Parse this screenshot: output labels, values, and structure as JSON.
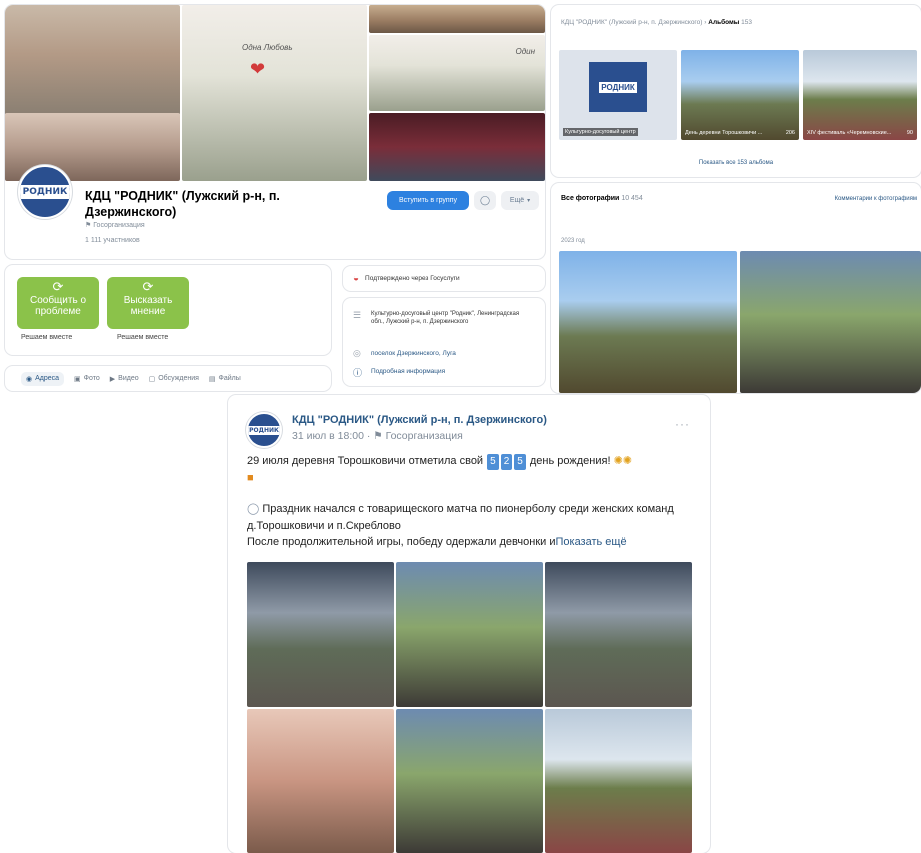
{
  "group": {
    "name": "КДЦ \"РОДНИК\" (Лужский р-н, п. Дзержинского)",
    "type": "Госорганизация",
    "members": "1 111 участников",
    "logo_text": "РОДНИК",
    "join_button": "Вступить в группу",
    "more_button": "Ещё"
  },
  "cover": {
    "banner_left": "Одна Любовь",
    "banner_right": "Один"
  },
  "actions": [
    {
      "label": "Сообщить о проблеме",
      "caption": "Решаем вместе"
    },
    {
      "label": "Высказать мнение",
      "caption": "Решаем вместе"
    }
  ],
  "tabs": [
    "Адреса",
    "Фото",
    "Видео",
    "Обсуждения",
    "Файлы"
  ],
  "gosuslugi": "Подтверждено через Госуслуги",
  "info": {
    "description": "Культурно-досуговый центр \"Родник\", Ленинградская обл., Лужский р-н, п. Дзержинского",
    "location": "поселок Дзержинского, Луга",
    "details": "Подробная информация"
  },
  "albums": {
    "breadcrumb_group": "КДЦ \"РОДНИК\" (Лужский р-н, п. Дзержинского)",
    "breadcrumb_sep": "›",
    "breadcrumb_albums": "Альбомы",
    "count": "153",
    "items": [
      {
        "title": "Культурно-досуговый центр",
        "count": ""
      },
      {
        "title": "День деревни Торошковичи ...",
        "count": "206"
      },
      {
        "title": "XIV фестиваль «Черемновские...",
        "count": "90"
      }
    ],
    "show_all": "Показать все 153 альбома"
  },
  "photos": {
    "title": "Все фотографии",
    "count": "10 454",
    "comments_link": "Комментарии к фотографиям",
    "year": "2023 год"
  },
  "post": {
    "author": "КДЦ \"РОДНИК\" (Лужский р-н, п. Дзержинского)",
    "date": "31 июл в 18:00",
    "type": "Госорганизация",
    "line1_before": "29 июля деревня Торошковичи отметила свой",
    "digits": [
      "5",
      "2",
      "5"
    ],
    "line1_after": "день рождения!",
    "para1": "Праздник начался с товарищеского матча по пионерболу среди женских команд д.Торошковичи и п.Скреблово",
    "para2": "После продолжительной игры, победу одержали девчонки и",
    "show_more": "Показать ещё"
  }
}
